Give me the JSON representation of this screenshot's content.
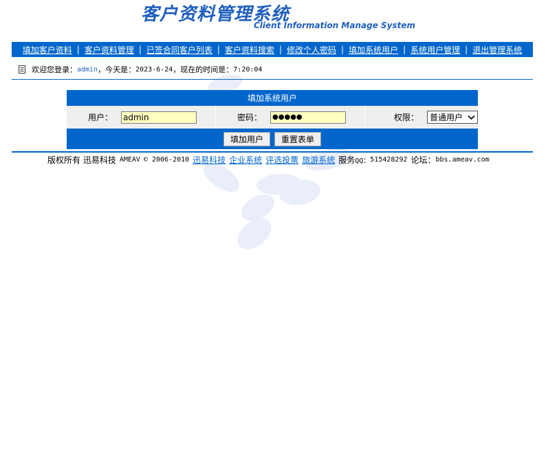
{
  "header": {
    "title_cn": "客户资料管理系统",
    "title_en": "Client Information Manage System"
  },
  "nav": {
    "items": [
      {
        "label": "填加客户资料"
      },
      {
        "label": "客户资料管理"
      },
      {
        "label": "已签合同客户列表"
      },
      {
        "label": "客户资料搜索"
      },
      {
        "label": "修改个人密码"
      },
      {
        "label": "填加系统用户"
      },
      {
        "label": "系统用户管理"
      },
      {
        "label": "退出管理系统"
      }
    ],
    "separator": "|"
  },
  "welcome": {
    "prefix": "欢迎您登录：",
    "username": "admin",
    "today_label": "，今天是：",
    "date": "2023-6-24",
    "time_label": "，现在的时间是：",
    "time": "7:20:04"
  },
  "form": {
    "title": "填加系统用户",
    "user_label": "用户：",
    "user_value": "admin",
    "password_label": "密码：",
    "password_value": "●●●●●",
    "role_label": "权限：",
    "role_selected": "普通用户",
    "submit_label": "填加用户",
    "reset_label": "重置表单"
  },
  "footer": {
    "copyright": "版权所有 迅易科技",
    "brand": "AMEAV",
    "years": "© 2006-2010",
    "links": [
      {
        "label": "迅易科技"
      },
      {
        "label": "企业系统"
      },
      {
        "label": "评选投票"
      },
      {
        "label": "旅游系统"
      }
    ],
    "service_label": "服务",
    "qq_label": "QQ：",
    "qq": "515428292",
    "forum_label": "论坛：",
    "forum": "bbs.ameav.com"
  },
  "colors": {
    "accent": "#0066cc",
    "logo": "#1f5fbf",
    "input_bg": "#ffffc0"
  }
}
